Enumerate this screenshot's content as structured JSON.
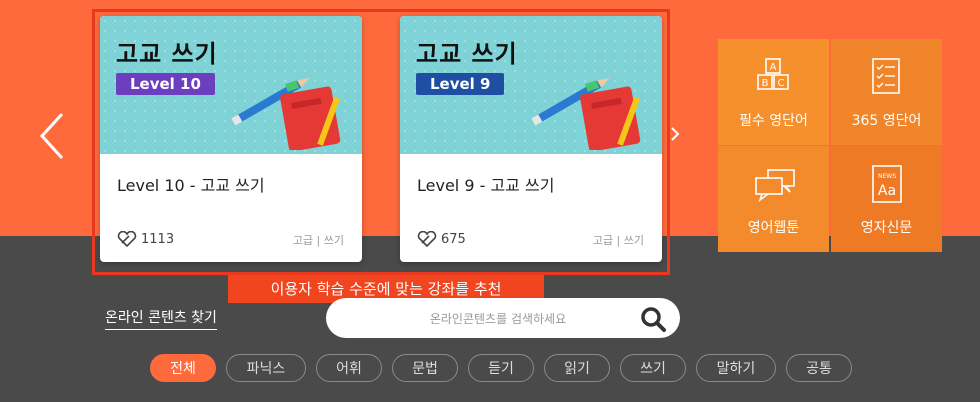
{
  "cards": [
    {
      "thumb_title": "고교 쓰기",
      "level_tag": "Level 10",
      "tag_color": "#6b3fbf",
      "title": "Level 10 - 고교 쓰기",
      "likes": "1113",
      "meta": "고급 | 쓰기"
    },
    {
      "thumb_title": "고교 쓰기",
      "level_tag": "Level 9",
      "tag_color": "#1f4fa3",
      "title": "Level 9 - 고교 쓰기",
      "likes": "675",
      "meta": "고급 | 쓰기"
    }
  ],
  "highlight_label": "이용자 학습 수준에 맞는 강좌를 추천",
  "tiles": [
    {
      "label": "필수 영단어",
      "icon": "abc-blocks-icon",
      "color": "#f5902c"
    },
    {
      "label": "365 영단어",
      "icon": "checklist-icon",
      "color": "#f1852a"
    },
    {
      "label": "영어웹툰",
      "icon": "speech-bubbles-icon",
      "color": "#f38a2b"
    },
    {
      "label": "영자신문",
      "icon": "newspaper-icon",
      "color": "#ee7a25"
    }
  ],
  "search": {
    "heading": "온라인 콘텐츠 찾기",
    "placeholder": "온라인콘텐츠를 검색하세요"
  },
  "filters": [
    "전체",
    "파닉스",
    "어휘",
    "문법",
    "듣기",
    "읽기",
    "쓰기",
    "말하기",
    "공통"
  ],
  "active_filter": "전체",
  "colors": {
    "primary": "#ff6a3d",
    "dark_band": "#4a4a4a",
    "highlight": "#e8381e"
  }
}
